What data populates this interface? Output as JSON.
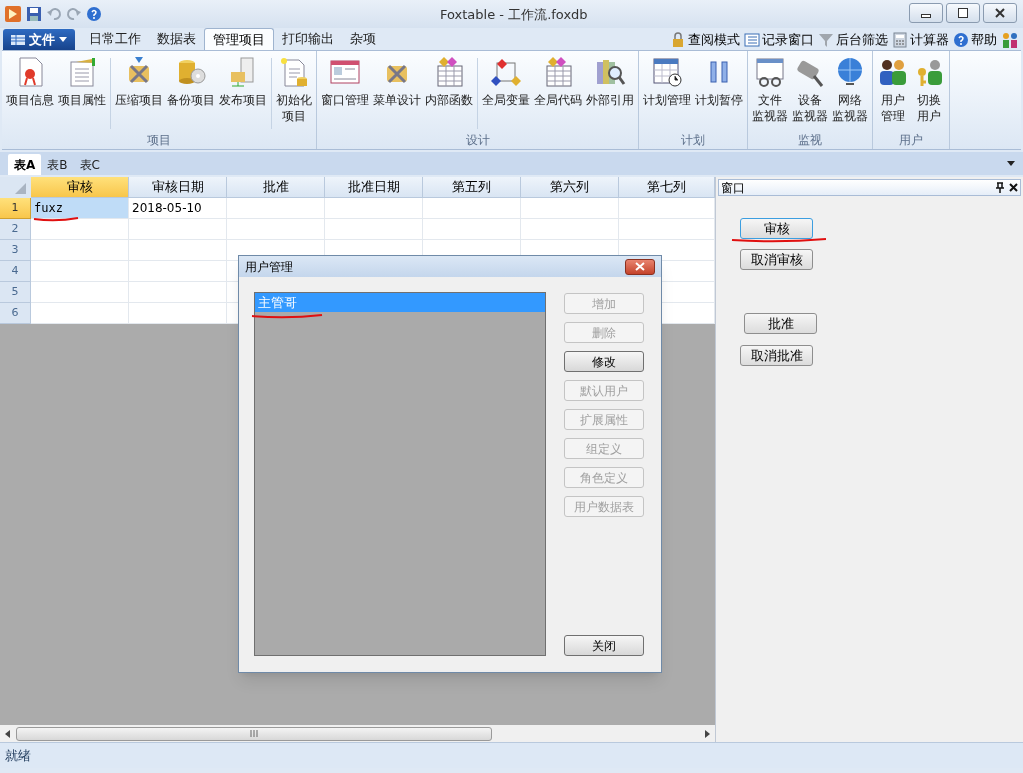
{
  "window": {
    "title": "Foxtable - 工作流.foxdb"
  },
  "file_button": "文件",
  "menu_tabs": [
    {
      "label": "日常工作",
      "selected": false
    },
    {
      "label": "数据表",
      "selected": false
    },
    {
      "label": "管理项目",
      "selected": true
    },
    {
      "label": "打印输出",
      "selected": false
    },
    {
      "label": "杂项",
      "selected": false
    }
  ],
  "quick_tools": [
    {
      "label": "查阅模式"
    },
    {
      "label": "记录窗口"
    },
    {
      "label": "后台筛选"
    },
    {
      "label": "计算器"
    },
    {
      "label": "帮助"
    }
  ],
  "ribbon_groups": [
    {
      "label": "项目",
      "buttons": [
        {
          "lines": [
            "项目信息"
          ]
        },
        {
          "lines": [
            "项目属性"
          ]
        },
        {
          "lines": [
            "压缩项目"
          ]
        },
        {
          "lines": [
            "备份项目"
          ]
        },
        {
          "lines": [
            "发布项目"
          ]
        },
        {
          "lines": [
            "初始化",
            "项目"
          ]
        }
      ]
    },
    {
      "label": "设计",
      "buttons": [
        {
          "lines": [
            "窗口管理"
          ]
        },
        {
          "lines": [
            "菜单设计"
          ]
        },
        {
          "lines": [
            "内部函数"
          ]
        },
        {
          "lines": [
            "全局变量"
          ]
        },
        {
          "lines": [
            "全局代码"
          ]
        },
        {
          "lines": [
            "外部引用"
          ]
        }
      ]
    },
    {
      "label": "计划",
      "buttons": [
        {
          "lines": [
            "计划管理"
          ]
        },
        {
          "lines": [
            "计划暂停"
          ]
        }
      ]
    },
    {
      "label": "监视",
      "buttons": [
        {
          "lines": [
            "文件",
            "监视器"
          ]
        },
        {
          "lines": [
            "设备",
            "监视器"
          ]
        },
        {
          "lines": [
            "网络",
            "监视器"
          ]
        }
      ]
    },
    {
      "label": "用户",
      "buttons": [
        {
          "lines": [
            "用户",
            "管理"
          ]
        },
        {
          "lines": [
            "切换",
            "用户"
          ]
        }
      ]
    }
  ],
  "sheet_tabs": [
    {
      "label": "表A",
      "selected": true
    },
    {
      "label": "表B",
      "selected": false
    },
    {
      "label": "表C",
      "selected": false
    }
  ],
  "table": {
    "columns": [
      {
        "label": "审核",
        "selected": true
      },
      {
        "label": "审核日期",
        "selected": false
      },
      {
        "label": "批准",
        "selected": false
      },
      {
        "label": "批准日期",
        "selected": false
      },
      {
        "label": "第五列",
        "selected": false
      },
      {
        "label": "第六列",
        "selected": false
      },
      {
        "label": "第七列",
        "selected": false
      }
    ],
    "rows": [
      {
        "number": "1",
        "selected": true,
        "marked": true,
        "cells": [
          "fuxz",
          "2018-05-10",
          "",
          "",
          "",
          "",
          ""
        ]
      },
      {
        "number": "2",
        "selected": false,
        "marked": false,
        "cells": [
          "",
          "",
          "",
          "",
          "",
          "",
          ""
        ]
      },
      {
        "number": "3",
        "selected": false,
        "marked": false,
        "cells": [
          "",
          "",
          "",
          "",
          "",
          "",
          ""
        ]
      },
      {
        "number": "4",
        "selected": false,
        "marked": false,
        "cells": [
          "",
          "",
          "",
          "",
          "",
          "",
          ""
        ]
      },
      {
        "number": "5",
        "selected": false,
        "marked": false,
        "cells": [
          "",
          "",
          "",
          "",
          "",
          "",
          ""
        ]
      },
      {
        "number": "6",
        "selected": false,
        "marked": false,
        "cells": [
          "",
          "",
          "",
          "",
          "",
          "",
          ""
        ]
      }
    ]
  },
  "panel": {
    "title": "窗口",
    "buttons": [
      {
        "label": "审核",
        "focused": true,
        "marked": true
      },
      {
        "label": "取消审核",
        "focused": false,
        "marked": false
      },
      {
        "label": "批准",
        "focused": false,
        "marked": false
      },
      {
        "label": "取消批准",
        "focused": false,
        "marked": false
      }
    ]
  },
  "dialog": {
    "title": "用户管理",
    "users": [
      {
        "label": "主管哥",
        "selected": true,
        "marked": true
      }
    ],
    "buttons": [
      {
        "label": "增加",
        "disabled": true
      },
      {
        "label": "删除",
        "disabled": true
      },
      {
        "label": "修改",
        "disabled": false
      },
      {
        "label": "默认用户",
        "disabled": true
      },
      {
        "label": "扩展属性",
        "disabled": true
      },
      {
        "label": "组定义",
        "disabled": true
      },
      {
        "label": "角色定义",
        "disabled": true
      },
      {
        "label": "用户数据表",
        "disabled": true
      }
    ],
    "close_button": "关闭"
  },
  "status_bar": "就绪"
}
